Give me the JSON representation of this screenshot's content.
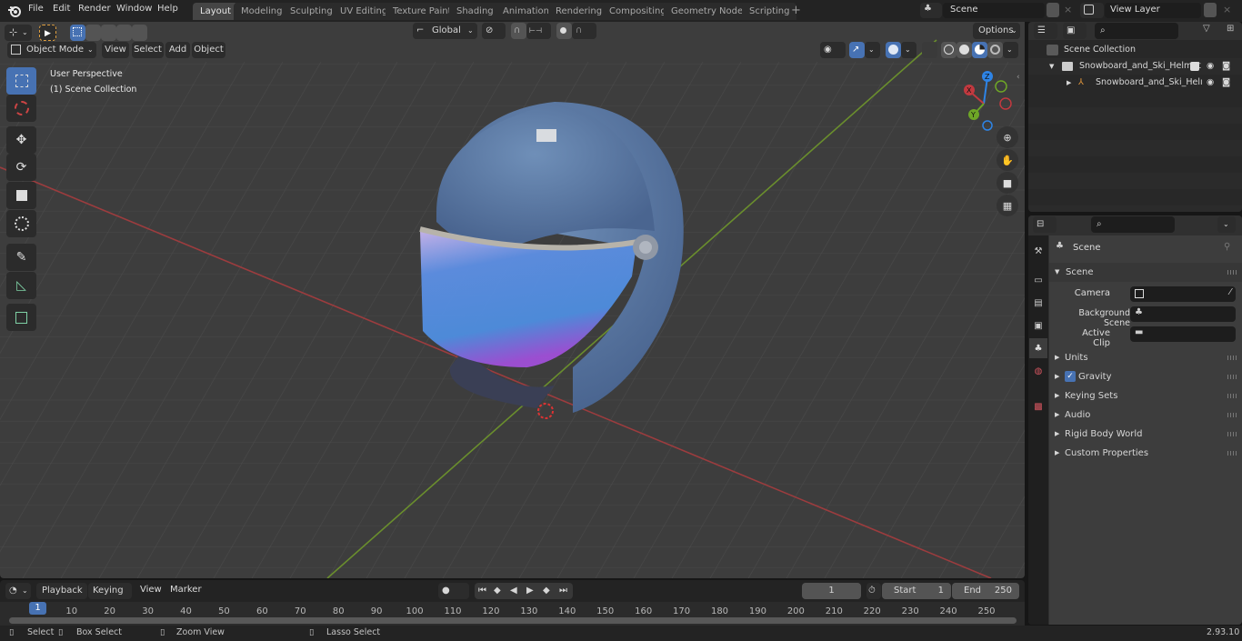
{
  "topbar": {
    "menus": [
      "File",
      "Edit",
      "Render",
      "Window",
      "Help"
    ],
    "workspaces": [
      "Layout",
      "Modeling",
      "Sculpting",
      "UV Editing",
      "Texture Paint",
      "Shading",
      "Animation",
      "Rendering",
      "Compositing",
      "Geometry Nodes",
      "Scripting"
    ],
    "active_workspace": "Layout",
    "add_workspace_icon": "plus-icon",
    "scene_name": "Scene",
    "view_layer_name": "View Layer"
  },
  "viewport": {
    "mode": "Object Mode",
    "menus": [
      "View",
      "Select",
      "Add",
      "Object"
    ],
    "transform_orientation": "Global",
    "options_label": "Options",
    "overlay_title": "User Perspective",
    "overlay_collection": "(1) Scene Collection",
    "tools": [
      "select-box",
      "cursor",
      "move",
      "rotate",
      "scale",
      "transform",
      "annotate",
      "measure",
      "add-cube"
    ],
    "active_tool": "select-box",
    "gizmo_axes": {
      "x": "X",
      "y": "Y",
      "z": "Z"
    },
    "nav_buttons": [
      "zoom",
      "pan",
      "camera",
      "grid"
    ],
    "shading_mode_active": "solid",
    "colors": {
      "x_axis": "#c2393f",
      "y_axis": "#6ea626",
      "z_axis": "#2e84e6",
      "accent": "#4772b3"
    }
  },
  "outliner": {
    "root": "Scene Collection",
    "items": [
      {
        "label": "Snowboard_and_Ski_Helmet",
        "type": "collection",
        "expanded": true,
        "checked": true,
        "visible": true,
        "renderable": true
      },
      {
        "label": "Snowboard_and_Ski_Helı",
        "type": "empty",
        "expanded": false,
        "visible": true,
        "renderable": true
      }
    ]
  },
  "properties": {
    "context_label": "Scene",
    "tabs": [
      "tool",
      "render",
      "output",
      "view-layer",
      "scene",
      "world",
      "texture"
    ],
    "active_tab": "scene",
    "panel_title": "Scene",
    "fields": [
      {
        "label": "Camera",
        "value": ""
      },
      {
        "label": "Background Scene",
        "value": ""
      },
      {
        "label": "Active Clip",
        "value": ""
      }
    ],
    "subpanels": [
      {
        "label": "Units"
      },
      {
        "label": "Gravity",
        "checkbox": true,
        "checked": true
      },
      {
        "label": "Keying Sets"
      },
      {
        "label": "Audio"
      },
      {
        "label": "Rigid Body World"
      },
      {
        "label": "Custom Properties"
      }
    ]
  },
  "timeline": {
    "menus": [
      "Playback",
      "Keying",
      "View",
      "Marker"
    ],
    "current_frame": "1",
    "start_label": "Start",
    "start": "1",
    "end_label": "End",
    "end": "250",
    "ticks": [
      "10",
      "20",
      "30",
      "40",
      "50",
      "60",
      "70",
      "80",
      "90",
      "100",
      "110",
      "120",
      "130",
      "140",
      "150",
      "160",
      "170",
      "180",
      "190",
      "200",
      "210",
      "220",
      "230",
      "240",
      "250"
    ],
    "playhead": "1"
  },
  "statusbar": {
    "items": [
      "Select",
      "Box Select",
      "Zoom View",
      "Lasso Select"
    ],
    "version": "2.93.10"
  }
}
